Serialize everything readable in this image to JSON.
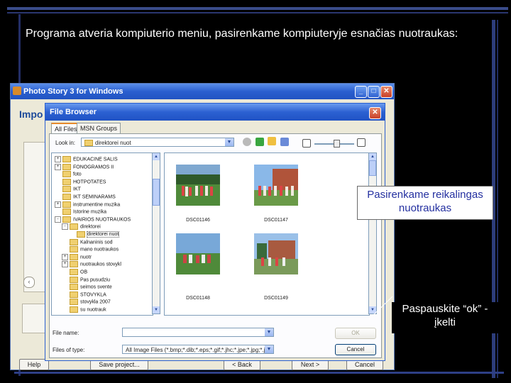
{
  "slide": {
    "title": "Programa atveria kompiuterio meniu, pasirenkame kompiuteryje esnačias nuotraukas:"
  },
  "photo_story": {
    "title": "Photo Story 3 for Windows",
    "heading": "Impo",
    "bottom_buttons": [
      "Help",
      "Save project...",
      "< Back",
      "Next >",
      "Cancel"
    ]
  },
  "file_browser": {
    "title": "File Browser",
    "tabs": [
      "All Files",
      "MSN Groups"
    ],
    "look_in_label": "Look in:",
    "look_in_value": "direktorei nuot",
    "tree_items": [
      {
        "label": "EDUKACINE SALIS",
        "level": 1,
        "expand": "+"
      },
      {
        "label": "FONOGRAMOS II",
        "level": 1,
        "expand": "+"
      },
      {
        "label": "foto",
        "level": 1,
        "expand": ""
      },
      {
        "label": "HOTPOTATES",
        "level": 1,
        "expand": ""
      },
      {
        "label": "IKT",
        "level": 1,
        "expand": ""
      },
      {
        "label": "IKT SEMINARAMS",
        "level": 1,
        "expand": ""
      },
      {
        "label": "instrumentine muzika",
        "level": 1,
        "expand": "+"
      },
      {
        "label": "Istorine muzika",
        "level": 1,
        "expand": ""
      },
      {
        "label": "IVAIRIOS NUOTRAUKOS",
        "level": 1,
        "expand": "-"
      },
      {
        "label": "direktorei",
        "level": 2,
        "expand": "-"
      },
      {
        "label": "direktorei nuot",
        "level": 3,
        "expand": ""
      },
      {
        "label": "Kalnaninis sod",
        "level": 2,
        "expand": ""
      },
      {
        "label": "mano nuotraukos",
        "level": 2,
        "expand": ""
      },
      {
        "label": "nuotr",
        "level": 2,
        "expand": "+"
      },
      {
        "label": "nuotraukos stovykl",
        "level": 2,
        "expand": "+"
      },
      {
        "label": "OB",
        "level": 2,
        "expand": ""
      },
      {
        "label": "Pas pusudziu",
        "level": 2,
        "expand": ""
      },
      {
        "label": "seimos svente",
        "level": 2,
        "expand": ""
      },
      {
        "label": "STOVYKLA",
        "level": 2,
        "expand": ""
      },
      {
        "label": "stovykla 2007",
        "level": 2,
        "expand": ""
      },
      {
        "label": "su nuotrauk",
        "level": 2,
        "expand": ""
      }
    ],
    "photos": [
      {
        "caption": "DSC01146"
      },
      {
        "caption": "DSC01147"
      },
      {
        "caption": "DSC01148"
      },
      {
        "caption": "DSC01149"
      }
    ],
    "file_name_label": "File name:",
    "file_name_value": "",
    "files_of_type_label": "Files of type:",
    "files_of_type_value": "All Image Files (*.bmp;*.dib;*.eps;*.gif;*.jhc;*.jpe;*.jpg;*.j",
    "ok_label": "OK",
    "cancel_label": "Cancel"
  },
  "callouts": {
    "select_photos": "Pasirenkame reikalingas nuotraukas",
    "press_ok": "Paspauskite “ok” - įkelti"
  },
  "colors": {
    "xp_title_blue": "#2a5fcf",
    "callout_text": "#2430a0",
    "slide_bg": "#000000"
  }
}
